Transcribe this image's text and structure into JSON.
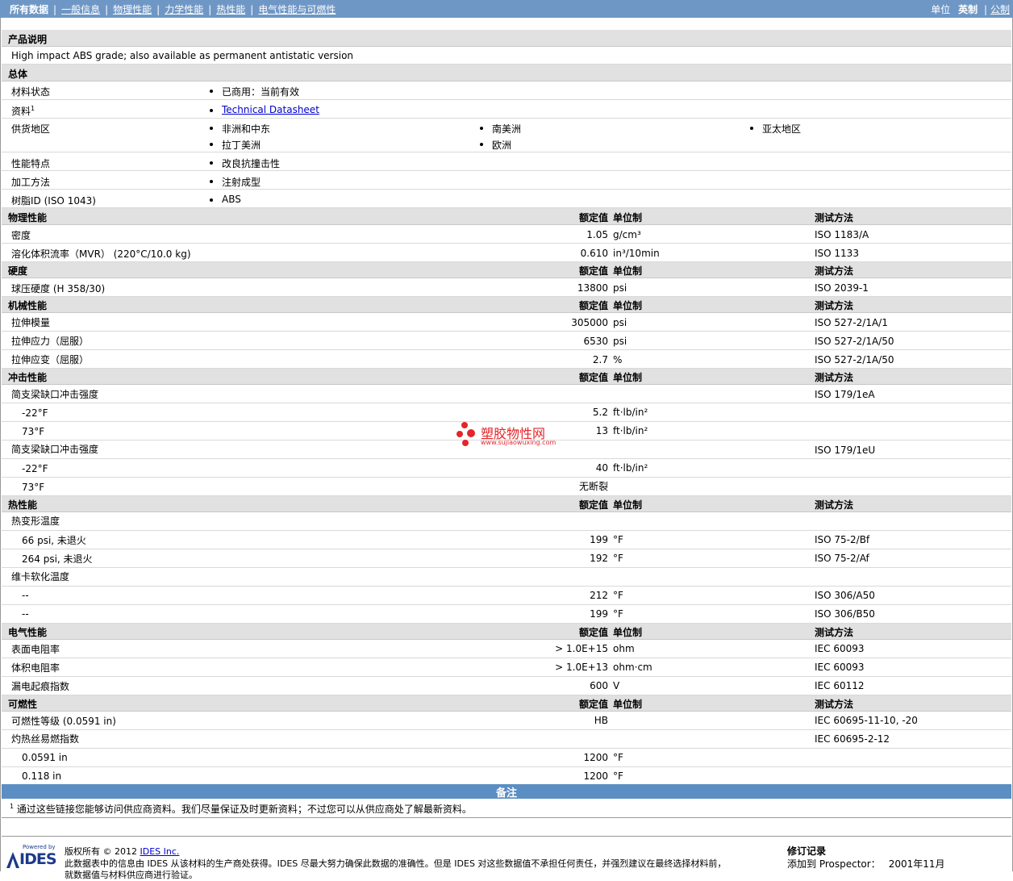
{
  "nav": {
    "items": [
      "所有数据",
      "一般信息",
      "物理性能",
      "力学性能",
      "热性能",
      "电气性能与可燃性"
    ],
    "separator": "|"
  },
  "units": {
    "label": "单位",
    "english": "英制",
    "separator": "|",
    "metric": "公制"
  },
  "product": {
    "title": "产品说明",
    "description": "High impact ABS grade; also available as permanent antistatic version"
  },
  "general": {
    "title": "总体",
    "status_label": "材料状态",
    "status_value": "已商用：当前有效",
    "docs_label": "资料",
    "docs_sup": "1",
    "docs_link": "Technical Datasheet",
    "supply_label": "供货地区",
    "supply": [
      "非洲和中东",
      "南美洲",
      "亚太地区",
      "拉丁美洲",
      "欧洲"
    ],
    "features_label": "性能特点",
    "features_value": "改良抗撞击性",
    "process_label": "加工方法",
    "process_value": "注射成型",
    "resin_label": "树脂ID (ISO 1043)",
    "resin_value": "ABS"
  },
  "col": {
    "nominal": "额定值",
    "unit": "单位制",
    "test": "测试方法"
  },
  "physical": {
    "title": "物理性能",
    "rows": [
      {
        "label": "密度",
        "value": "1.05",
        "unit": "g/cm³",
        "test": "ISO 1183/A"
      },
      {
        "label": "溶化体积流率（MVR） (220°C/10.0 kg)",
        "value": "0.610",
        "unit": "in³/10min",
        "test": "ISO 1133"
      }
    ]
  },
  "hardness": {
    "title": "硬度",
    "rows": [
      {
        "label": "球压硬度 (H 358/30)",
        "value": "13800",
        "unit": "psi",
        "test": "ISO 2039-1"
      }
    ]
  },
  "mechanical": {
    "title": "机械性能",
    "rows": [
      {
        "label": "拉伸模量",
        "value": "305000",
        "unit": "psi",
        "test": "ISO 527-2/1A/1"
      },
      {
        "label": "拉伸应力（屈服）",
        "value": "6530",
        "unit": "psi",
        "test": "ISO 527-2/1A/50"
      },
      {
        "label": "拉伸应变（屈服）",
        "value": "2.7",
        "unit": "%",
        "test": "ISO 527-2/1A/50"
      }
    ]
  },
  "impact": {
    "title": "冲击性能",
    "g1_label": "简支梁缺口冲击强度",
    "g1_test": "ISO 179/1eA",
    "g1_rows": [
      {
        "label": "-22°F",
        "value": "5.2",
        "unit": "ft·lb/in²"
      },
      {
        "label": "73°F",
        "value": "13",
        "unit": "ft·lb/in²"
      }
    ],
    "g2_label": "简支梁缺口冲击强度",
    "g2_test": "ISO 179/1eU",
    "g2_rows": [
      {
        "label": "-22°F",
        "value": "40",
        "unit": "ft·lb/in²"
      },
      {
        "label": "73°F",
        "value": "无断裂",
        "unit": ""
      }
    ]
  },
  "thermal": {
    "title": "热性能",
    "g1_label": "热变形温度",
    "g1_rows": [
      {
        "label": "66 psi, 未退火",
        "value": "199",
        "unit": "°F",
        "test": "ISO 75-2/Bf"
      },
      {
        "label": "264 psi, 未退火",
        "value": "192",
        "unit": "°F",
        "test": "ISO 75-2/Af"
      }
    ],
    "g2_label": "维卡软化温度",
    "g2_rows": [
      {
        "label": "--",
        "value": "212",
        "unit": "°F",
        "test": "ISO 306/A50"
      },
      {
        "label": "--",
        "value": "199",
        "unit": "°F",
        "test": "ISO 306/B50"
      }
    ]
  },
  "electrical": {
    "title": "电气性能",
    "rows": [
      {
        "label": "表面电阻率",
        "value": "> 1.0E+15",
        "unit": "ohm",
        "test": "IEC 60093"
      },
      {
        "label": "体积电阻率",
        "value": "> 1.0E+13",
        "unit": "ohm·cm",
        "test": "IEC 60093"
      },
      {
        "label": "漏电起痕指数",
        "value": "600",
        "unit": "V",
        "test": "IEC 60112"
      }
    ]
  },
  "flammability": {
    "title": "可燃性",
    "rating_label": "可燃性等级 (0.0591 in)",
    "rating_value": "HB",
    "rating_test": "IEC 60695-11-10, -20",
    "gwfi_label": "灼热丝易燃指数",
    "gwfi_test": "IEC 60695-2-12",
    "gwfi_rows": [
      {
        "label": "0.0591 in",
        "value": "1200",
        "unit": "°F"
      },
      {
        "label": "0.118 in",
        "value": "1200",
        "unit": "°F"
      }
    ]
  },
  "notes": {
    "title": "备注",
    "sup": "1",
    "text": "通过这些链接您能够访问供应商资料。我们尽量保证及时更新资料；不过您可以从供应商处了解最新资料。"
  },
  "watermark": {
    "cn": "塑胶物性网",
    "url": "www.sujiaowuxing.com"
  },
  "footer": {
    "powered_by": "Powered by",
    "logo_text": "IDES",
    "copyright_prefix": "版权所有 © 2012 ",
    "copyright_link": "IDES Inc.",
    "disclaimer": "此数据表中的信息由 IDES 从该材料的生产商处获得。IDES 尽最大努力确保此数据的准确性。但是 IDES 对这些数据值不承担任何责任，并强烈建议在最终选择材料前，",
    "disclaimer2": "就数据值与材料供应商进行验证。",
    "revision_title": "修订记录",
    "revision_label": "添加到 Prospector：",
    "revision_date": "2001年11月"
  },
  "colors": {
    "topbar": "#6f97c6",
    "header_row": "#e1e1e1",
    "notes_bar": "#5b8ec3",
    "link": "#0000cc",
    "watermark": "#e5252a"
  }
}
